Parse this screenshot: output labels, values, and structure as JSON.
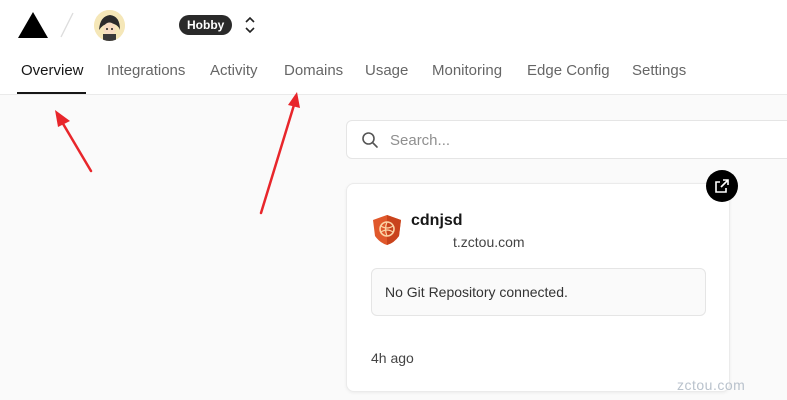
{
  "header": {
    "logo_icon": "vercel-triangle-icon",
    "separator_icon": "slash-icon",
    "avatar_icon": "user-avatar",
    "plan_badge": "Hobby",
    "switcher_icon": "chevron-up-down-icon"
  },
  "tabs": [
    {
      "label": "Overview",
      "active": true
    },
    {
      "label": "Integrations",
      "active": false
    },
    {
      "label": "Activity",
      "active": false
    },
    {
      "label": "Domains",
      "active": false
    },
    {
      "label": "Usage",
      "active": false
    },
    {
      "label": "Monitoring",
      "active": false
    },
    {
      "label": "Edge Config",
      "active": false
    },
    {
      "label": "Settings",
      "active": false
    }
  ],
  "search": {
    "placeholder": "Search...",
    "value": "",
    "icon": "search-icon"
  },
  "project_card": {
    "name": "cdnjsd",
    "domain": "t.zctou.com",
    "git_status": "No Git Repository connected.",
    "updated": "4h ago",
    "project_icon": "shield-project-icon",
    "external_link_icon": "external-link-icon"
  },
  "watermark": "zctou.com",
  "colors": {
    "annotation_arrow": "#e8262b",
    "accent": "#171717",
    "badge_bg": "#2a2a2a",
    "project_icon": "#e0582b"
  }
}
